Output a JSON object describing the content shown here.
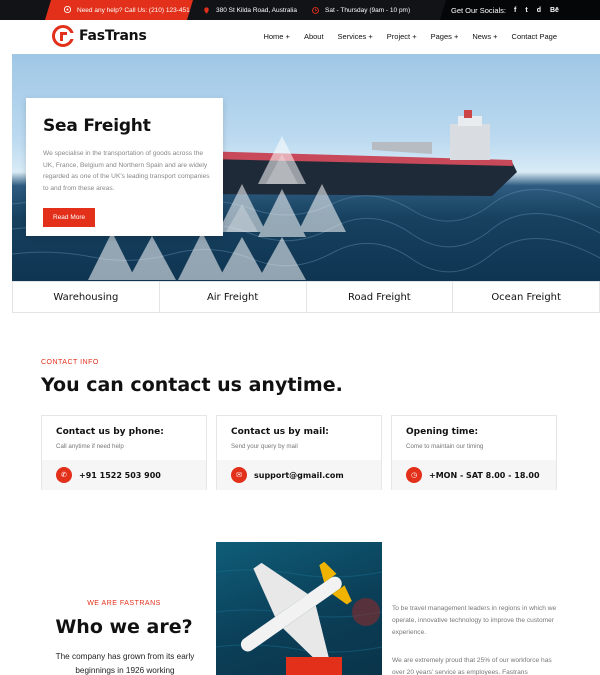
{
  "topbar": {
    "help_text": "Need any help? Call Us: (210) 123-451",
    "address": "380 St Kilda Road, Australia",
    "hours": "Sat - Thursday (9am - 10 pm)",
    "socials_label": "Get Our Socials:",
    "socials": [
      "f",
      "t",
      "d",
      "Bē"
    ]
  },
  "header": {
    "logo_text": "FasTrans",
    "nav": [
      "Home +",
      "About",
      "Services +",
      "Project +",
      "Pages +",
      "News +",
      "Contact Page"
    ]
  },
  "hero": {
    "title": "Sea Freight",
    "description": "We specialise in the transportation of goods across the UK, France, Belgium and Northern Spain and are widely regarded as one of the UK's leading transport companies to and from these areas.",
    "button": "Read More"
  },
  "service_tabs": [
    "Warehousing",
    "Air Freight",
    "Road Freight",
    "Ocean Freight"
  ],
  "contact": {
    "kicker": "CONTACT INFO",
    "title": "You can contact us anytime.",
    "cards": [
      {
        "heading": "Contact us by phone:",
        "sub": "Call anytime if need help",
        "value": "+91 1522 503 900",
        "icon": "phone-icon"
      },
      {
        "heading": "Contact us by mail:",
        "sub": "Send your query by mail",
        "value": "support@gmail.com",
        "icon": "mail-icon"
      },
      {
        "heading": "Opening time:",
        "sub": "Come to maintain our timing",
        "value": "+MON - SAT 8.00 - 18.00",
        "icon": "clock-icon"
      }
    ]
  },
  "about": {
    "kicker": "WE ARE FASTRANS",
    "title": "Who we are?",
    "text": "The company has grown from its early beginnings in 1926 working",
    "para1": "To be travel management leaders in regions in which we operate, innovative technology to improve the customer experience.",
    "para2": "We are extremely proud that 25% of our workforce has over 20 years' service as employees. Fastrans"
  },
  "colors": {
    "accent": "#e2301a",
    "dark": "#111317"
  }
}
